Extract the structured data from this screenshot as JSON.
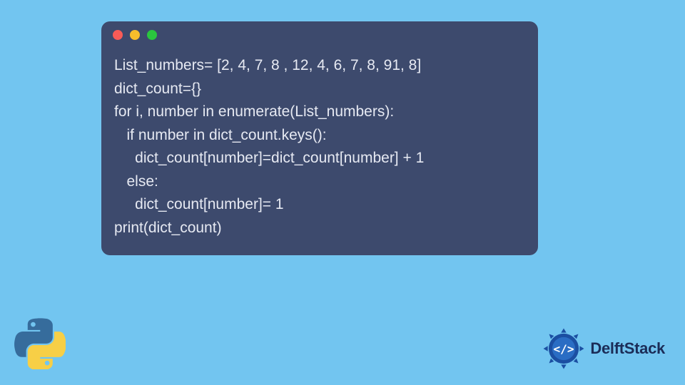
{
  "window": {
    "dots": {
      "red": "#f95b57",
      "yellow": "#f7bd2b",
      "green": "#2ac63e"
    }
  },
  "code": {
    "lines": [
      "List_numbers= [2, 4, 7, 8 , 12, 4, 6, 7, 8, 91, 8]",
      "dict_count={}",
      "for i, number in enumerate(List_numbers):",
      "   if number in dict_count.keys():",
      "     dict_count[number]=dict_count[number] + 1",
      "   else:",
      "     dict_count[number]= 1",
      "print(dict_count)"
    ]
  },
  "brand": {
    "name": "DelftStack"
  },
  "colors": {
    "background": "#72c5f0",
    "window_bg": "#3d4a6d",
    "code_text": "#e6e9f2",
    "brand_text": "#1b2d58",
    "python_blue": "#366c9c",
    "python_yellow": "#f7cf46"
  }
}
